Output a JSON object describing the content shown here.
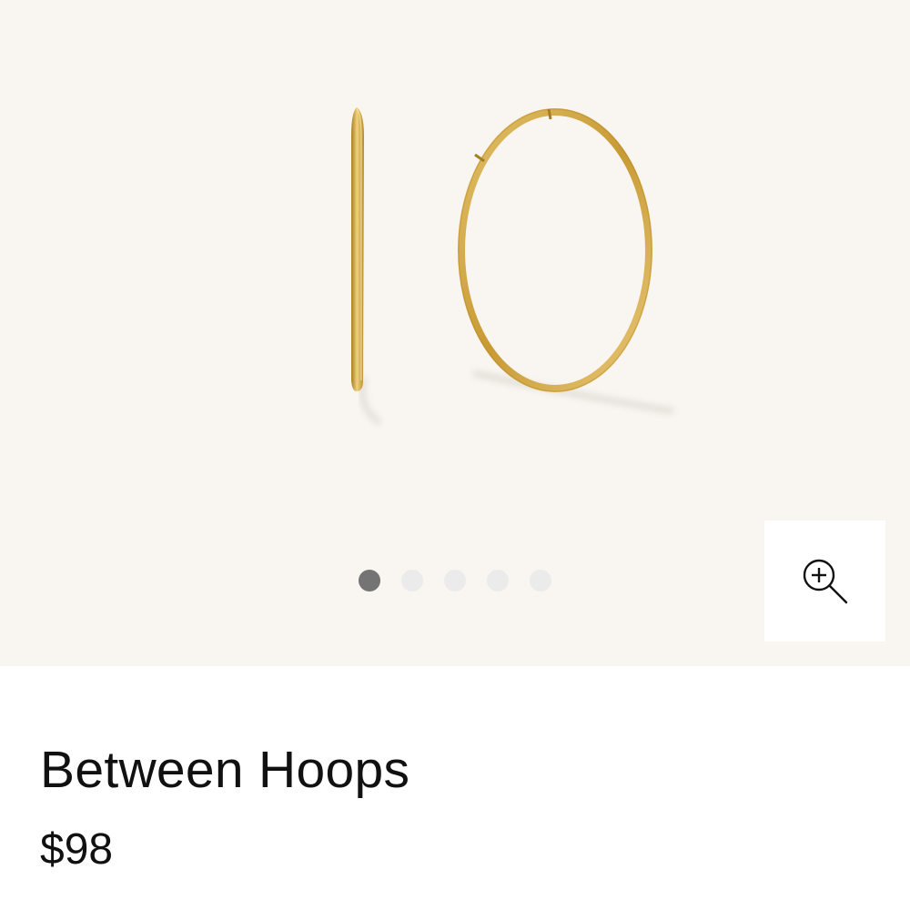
{
  "product": {
    "title": "Between Hoops",
    "price": "$98"
  },
  "gallery": {
    "image": "gold-hoop-earrings-image",
    "slide_count": 5,
    "active_slide": 1,
    "zoom_icon": "zoom-in-icon"
  },
  "colors": {
    "gallery_background": "#f9f6f1",
    "gold": "#d1a83c",
    "dot_active": "#747474",
    "dot_inactive": "#ebebeb"
  }
}
